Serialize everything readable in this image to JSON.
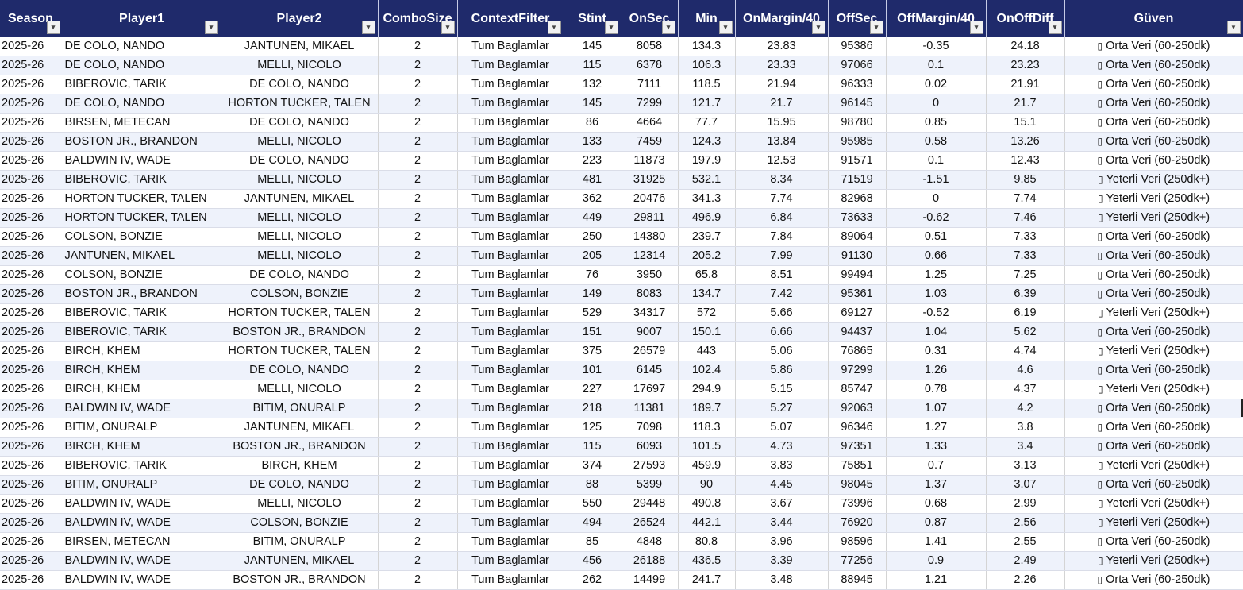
{
  "columns": [
    {
      "key": "season",
      "label": "Season"
    },
    {
      "key": "player1",
      "label": "Player1"
    },
    {
      "key": "player2",
      "label": "Player2"
    },
    {
      "key": "combo",
      "label": "ComboSize"
    },
    {
      "key": "context",
      "label": "ContextFilter"
    },
    {
      "key": "stint",
      "label": "Stint"
    },
    {
      "key": "onsec",
      "label": "OnSec"
    },
    {
      "key": "min",
      "label": "Min"
    },
    {
      "key": "onmargin",
      "label": "OnMargin/40"
    },
    {
      "key": "offsec",
      "label": "OffSec"
    },
    {
      "key": "offmargin",
      "label": "OffMargin/40"
    },
    {
      "key": "onoffdiff",
      "label": "OnOffDiff"
    },
    {
      "key": "guven",
      "label": "Güven"
    }
  ],
  "icons": {
    "filter": "dropdown-arrow-icon",
    "filter_active": "filter-active-icon",
    "guven_prefix": "missing-glyph-box-icon"
  },
  "rows": [
    [
      "2025-26",
      "DE COLO, NANDO",
      "JANTUNEN, MIKAEL",
      "2",
      "Tum Baglamlar",
      "145",
      "8058",
      "134.3",
      "23.83",
      "95386",
      "-0.35",
      "24.18",
      "Orta Veri (60-250dk)"
    ],
    [
      "2025-26",
      "DE COLO, NANDO",
      "MELLI, NICOLO",
      "2",
      "Tum Baglamlar",
      "115",
      "6378",
      "106.3",
      "23.33",
      "97066",
      "0.1",
      "23.23",
      "Orta Veri (60-250dk)"
    ],
    [
      "2025-26",
      "BIBEROVIC, TARIK",
      "DE COLO, NANDO",
      "2",
      "Tum Baglamlar",
      "132",
      "7111",
      "118.5",
      "21.94",
      "96333",
      "0.02",
      "21.91",
      "Orta Veri (60-250dk)"
    ],
    [
      "2025-26",
      "DE COLO, NANDO",
      "HORTON TUCKER, TALEN",
      "2",
      "Tum Baglamlar",
      "145",
      "7299",
      "121.7",
      "21.7",
      "96145",
      "0",
      "21.7",
      "Orta Veri (60-250dk)"
    ],
    [
      "2025-26",
      "BIRSEN, METECAN",
      "DE COLO, NANDO",
      "2",
      "Tum Baglamlar",
      "86",
      "4664",
      "77.7",
      "15.95",
      "98780",
      "0.85",
      "15.1",
      "Orta Veri (60-250dk)"
    ],
    [
      "2025-26",
      "BOSTON JR., BRANDON",
      "MELLI, NICOLO",
      "2",
      "Tum Baglamlar",
      "133",
      "7459",
      "124.3",
      "13.84",
      "95985",
      "0.58",
      "13.26",
      "Orta Veri (60-250dk)"
    ],
    [
      "2025-26",
      "BALDWIN IV, WADE",
      "DE COLO, NANDO",
      "2",
      "Tum Baglamlar",
      "223",
      "11873",
      "197.9",
      "12.53",
      "91571",
      "0.1",
      "12.43",
      "Orta Veri (60-250dk)"
    ],
    [
      "2025-26",
      "BIBEROVIC, TARIK",
      "MELLI, NICOLO",
      "2",
      "Tum Baglamlar",
      "481",
      "31925",
      "532.1",
      "8.34",
      "71519",
      "-1.51",
      "9.85",
      "Yeterli Veri (250dk+)"
    ],
    [
      "2025-26",
      "HORTON TUCKER, TALEN",
      "JANTUNEN, MIKAEL",
      "2",
      "Tum Baglamlar",
      "362",
      "20476",
      "341.3",
      "7.74",
      "82968",
      "0",
      "7.74",
      "Yeterli Veri (250dk+)"
    ],
    [
      "2025-26",
      "HORTON TUCKER, TALEN",
      "MELLI, NICOLO",
      "2",
      "Tum Baglamlar",
      "449",
      "29811",
      "496.9",
      "6.84",
      "73633",
      "-0.62",
      "7.46",
      "Yeterli Veri (250dk+)"
    ],
    [
      "2025-26",
      "COLSON, BONZIE",
      "MELLI, NICOLO",
      "2",
      "Tum Baglamlar",
      "250",
      "14380",
      "239.7",
      "7.84",
      "89064",
      "0.51",
      "7.33",
      "Orta Veri (60-250dk)"
    ],
    [
      "2025-26",
      "JANTUNEN, MIKAEL",
      "MELLI, NICOLO",
      "2",
      "Tum Baglamlar",
      "205",
      "12314",
      "205.2",
      "7.99",
      "91130",
      "0.66",
      "7.33",
      "Orta Veri (60-250dk)"
    ],
    [
      "2025-26",
      "COLSON, BONZIE",
      "DE COLO, NANDO",
      "2",
      "Tum Baglamlar",
      "76",
      "3950",
      "65.8",
      "8.51",
      "99494",
      "1.25",
      "7.25",
      "Orta Veri (60-250dk)"
    ],
    [
      "2025-26",
      "BOSTON JR., BRANDON",
      "COLSON, BONZIE",
      "2",
      "Tum Baglamlar",
      "149",
      "8083",
      "134.7",
      "7.42",
      "95361",
      "1.03",
      "6.39",
      "Orta Veri (60-250dk)"
    ],
    [
      "2025-26",
      "BIBEROVIC, TARIK",
      "HORTON TUCKER, TALEN",
      "2",
      "Tum Baglamlar",
      "529",
      "34317",
      "572",
      "5.66",
      "69127",
      "-0.52",
      "6.19",
      "Yeterli Veri (250dk+)"
    ],
    [
      "2025-26",
      "BIBEROVIC, TARIK",
      "BOSTON JR., BRANDON",
      "2",
      "Tum Baglamlar",
      "151",
      "9007",
      "150.1",
      "6.66",
      "94437",
      "1.04",
      "5.62",
      "Orta Veri (60-250dk)"
    ],
    [
      "2025-26",
      "BIRCH, KHEM",
      "HORTON TUCKER, TALEN",
      "2",
      "Tum Baglamlar",
      "375",
      "26579",
      "443",
      "5.06",
      "76865",
      "0.31",
      "4.74",
      "Yeterli Veri (250dk+)"
    ],
    [
      "2025-26",
      "BIRCH, KHEM",
      "DE COLO, NANDO",
      "2",
      "Tum Baglamlar",
      "101",
      "6145",
      "102.4",
      "5.86",
      "97299",
      "1.26",
      "4.6",
      "Orta Veri (60-250dk)"
    ],
    [
      "2025-26",
      "BIRCH, KHEM",
      "MELLI, NICOLO",
      "2",
      "Tum Baglamlar",
      "227",
      "17697",
      "294.9",
      "5.15",
      "85747",
      "0.78",
      "4.37",
      "Yeterli Veri (250dk+)"
    ],
    [
      "2025-26",
      "BALDWIN IV, WADE",
      "BITIM, ONURALP",
      "2",
      "Tum Baglamlar",
      "218",
      "11381",
      "189.7",
      "5.27",
      "92063",
      "1.07",
      "4.2",
      "Orta Veri (60-250dk)"
    ],
    [
      "2025-26",
      "BITIM, ONURALP",
      "JANTUNEN, MIKAEL",
      "2",
      "Tum Baglamlar",
      "125",
      "7098",
      "118.3",
      "5.07",
      "96346",
      "1.27",
      "3.8",
      "Orta Veri (60-250dk)"
    ],
    [
      "2025-26",
      "BIRCH, KHEM",
      "BOSTON JR., BRANDON",
      "2",
      "Tum Baglamlar",
      "115",
      "6093",
      "101.5",
      "4.73",
      "97351",
      "1.33",
      "3.4",
      "Orta Veri (60-250dk)"
    ],
    [
      "2025-26",
      "BIBEROVIC, TARIK",
      "BIRCH, KHEM",
      "2",
      "Tum Baglamlar",
      "374",
      "27593",
      "459.9",
      "3.83",
      "75851",
      "0.7",
      "3.13",
      "Yeterli Veri (250dk+)"
    ],
    [
      "2025-26",
      "BITIM, ONURALP",
      "DE COLO, NANDO",
      "2",
      "Tum Baglamlar",
      "88",
      "5399",
      "90",
      "4.45",
      "98045",
      "1.37",
      "3.07",
      "Orta Veri (60-250dk)"
    ],
    [
      "2025-26",
      "BALDWIN IV, WADE",
      "MELLI, NICOLO",
      "2",
      "Tum Baglamlar",
      "550",
      "29448",
      "490.8",
      "3.67",
      "73996",
      "0.68",
      "2.99",
      "Yeterli Veri (250dk+)"
    ],
    [
      "2025-26",
      "BALDWIN IV, WADE",
      "COLSON, BONZIE",
      "2",
      "Tum Baglamlar",
      "494",
      "26524",
      "442.1",
      "3.44",
      "76920",
      "0.87",
      "2.56",
      "Yeterli Veri (250dk+)"
    ],
    [
      "2025-26",
      "BIRSEN, METECAN",
      "BITIM, ONURALP",
      "2",
      "Tum Baglamlar",
      "85",
      "4848",
      "80.8",
      "3.96",
      "98596",
      "1.41",
      "2.55",
      "Orta Veri (60-250dk)"
    ],
    [
      "2025-26",
      "BALDWIN IV, WADE",
      "JANTUNEN, MIKAEL",
      "2",
      "Tum Baglamlar",
      "456",
      "26188",
      "436.5",
      "3.39",
      "77256",
      "0.9",
      "2.49",
      "Yeterli Veri (250dk+)"
    ],
    [
      "2025-26",
      "BALDWIN IV, WADE",
      "BOSTON JR., BRANDON",
      "2",
      "Tum Baglamlar",
      "262",
      "14499",
      "241.7",
      "3.48",
      "88945",
      "1.21",
      "2.26",
      "Orta Veri (60-250dk)"
    ]
  ]
}
